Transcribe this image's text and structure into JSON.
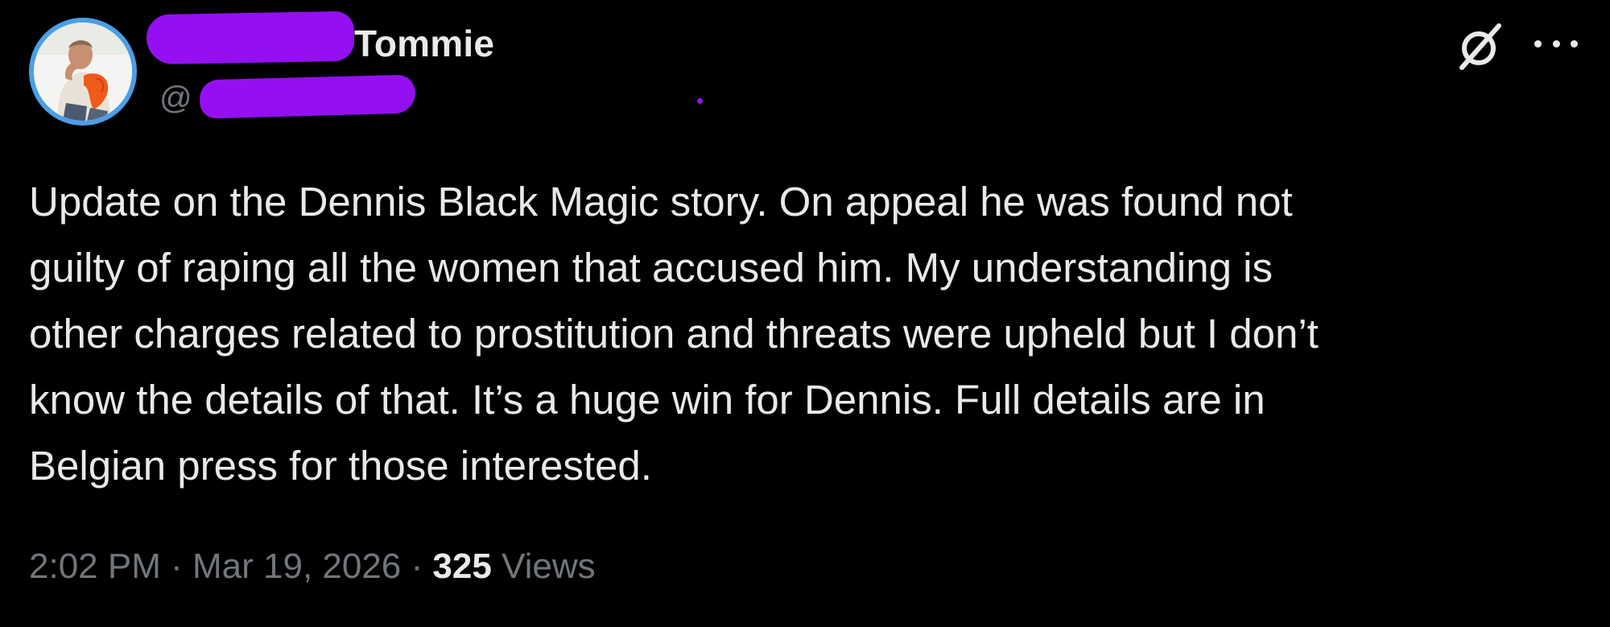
{
  "author": {
    "display_name": "Tommie",
    "handle_prefix": "@",
    "avatar": "avatar-photo",
    "avatar_ring_color": "#4a9fe6",
    "redaction_color": "#9410f2"
  },
  "actions": {
    "grok_icon": "grok-icon",
    "more_icon": "more-options-icon"
  },
  "tweet": {
    "text_lines": [
      "Update on the Dennis Black Magic story. On appeal he was found not",
      "guilty of raping all the women that accused him. My understanding is",
      "other charges related to prostitution and threats were upheld but I don’t",
      "know the details of that. It’s a huge win for Dennis. Full details are in",
      "Belgian press for those interested."
    ]
  },
  "meta": {
    "time": "2:02 PM",
    "separator": "·",
    "date": "Mar 19, 2026",
    "views_count": "325",
    "views_label": "Views"
  },
  "colors": {
    "background": "#000000",
    "primary_text": "#e7e9ea",
    "secondary_text": "#71767b"
  }
}
